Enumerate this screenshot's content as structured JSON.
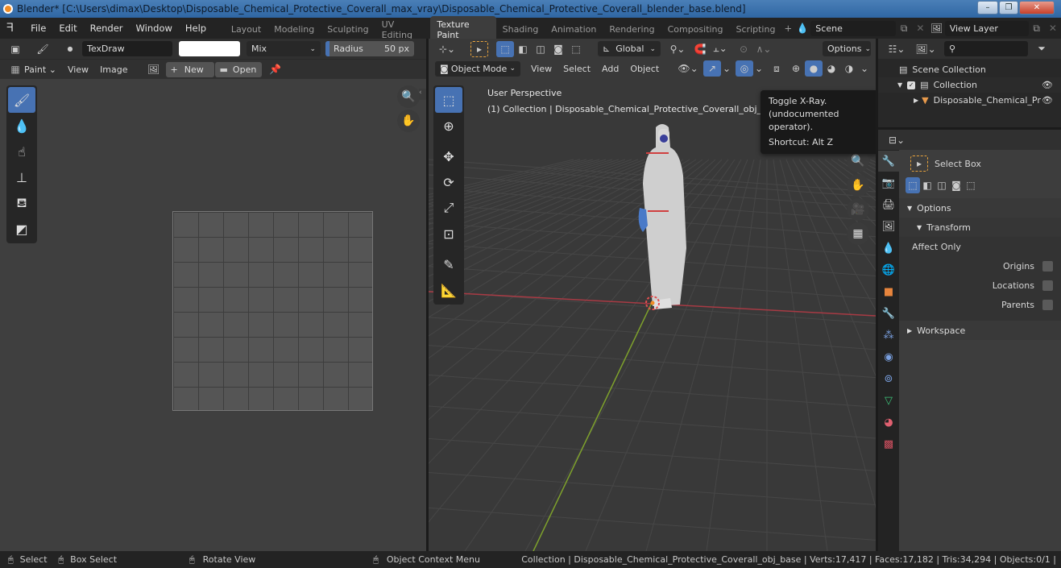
{
  "window": {
    "title": "Blender* [C:\\Users\\dimax\\Desktop\\Disposable_Chemical_Protective_Coverall_max_vray\\Disposable_Chemical_Protective_Coverall_blender_base.blend]",
    "minimize": "–",
    "maximize": "❐",
    "close": "✕"
  },
  "topbar": {
    "menus": [
      "File",
      "Edit",
      "Render",
      "Window",
      "Help"
    ],
    "workspaces": [
      "Layout",
      "Modeling",
      "Sculpting",
      "UV Editing",
      "Texture Paint",
      "Shading",
      "Animation",
      "Rendering",
      "Compositing",
      "Scripting"
    ],
    "active_workspace": "Texture Paint",
    "add_workspace": "+",
    "scene": "Scene",
    "view_layer": "View Layer"
  },
  "image_editor": {
    "brush_name": "TexDraw",
    "color_hex": "#ffffff",
    "blend_mode": "Mix",
    "radius_label": "Radius",
    "radius_value": "50 px",
    "mode": "Paint",
    "menus": [
      "View",
      "Image"
    ],
    "new_label": "New",
    "open_label": "Open",
    "tools": [
      "brush-draw",
      "soften",
      "smear",
      "clone",
      "fill",
      "mask"
    ]
  },
  "viewport": {
    "mode": "Object Mode",
    "menus": [
      "View",
      "Select",
      "Add",
      "Object"
    ],
    "orientation": "Global",
    "options_label": "Options",
    "overlay_title": "User Perspective",
    "overlay_subtitle": "(1) Collection | Disposable_Chemical_Protective_Coverall_obj_base",
    "tooltip": {
      "line1": "Toggle X-Ray.",
      "line2": "(undocumented operator).",
      "shortcut": "Shortcut: Alt Z"
    },
    "tools": [
      "select-box",
      "cursor",
      "move",
      "rotate",
      "scale",
      "transform",
      "annotate",
      "measure"
    ],
    "axis_colors": {
      "x": "#a83a44",
      "y": "#7ea12c"
    }
  },
  "outliner": {
    "search_placeholder": "",
    "items": [
      {
        "label": "Scene Collection",
        "level": 0
      },
      {
        "label": "Collection",
        "level": 1,
        "checked": true
      },
      {
        "label": "Disposable_Chemical_Pr",
        "level": 2
      }
    ]
  },
  "properties": {
    "tool_name": "Select Box",
    "options_label": "Options",
    "transform_label": "Transform",
    "affect_only_label": "Affect Only",
    "checkboxes": [
      {
        "label": "Origins",
        "checked": false
      },
      {
        "label": "Locations",
        "checked": false
      },
      {
        "label": "Parents",
        "checked": false
      }
    ],
    "workspace_label": "Workspace"
  },
  "statusbar": {
    "select": "Select",
    "box_select": "Box Select",
    "rotate_view": "Rotate View",
    "context_menu": "Object Context Menu",
    "stats": "Collection | Disposable_Chemical_Protective_Coverall_obj_base | Verts:17,417 | Faces:17,182 | Tris:34,294 | Objects:0/1 |"
  },
  "colors": {
    "accent": "#4772b3",
    "tool_highlight": "#e8a33d"
  }
}
